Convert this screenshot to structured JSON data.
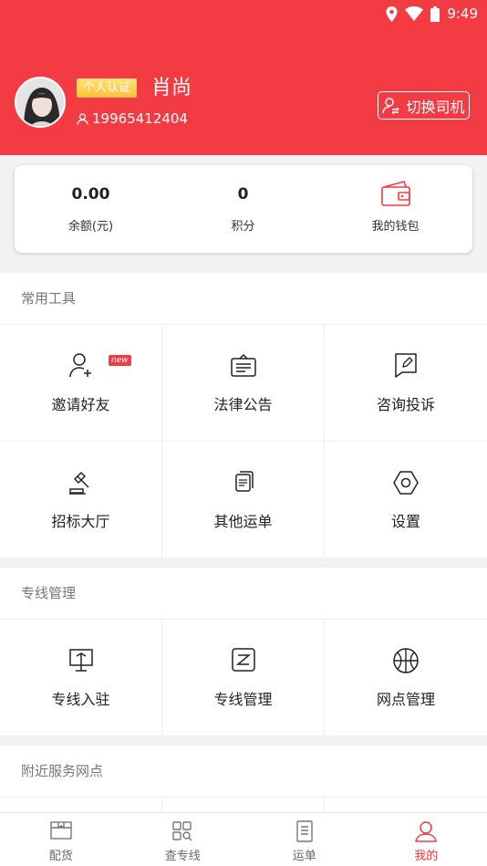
{
  "status_bar": {
    "time": "9:49",
    "icons": [
      "location-icon",
      "wifi-icon",
      "battery-icon"
    ]
  },
  "profile": {
    "badge": "个人认证",
    "name": "肖尚",
    "phone": "19965412404",
    "switch_label": "切换司机"
  },
  "wallet": {
    "balance_value": "0.00",
    "balance_label": "余额(元)",
    "points_value": "0",
    "points_label": "积分",
    "wallet_label": "我的钱包"
  },
  "tools": {
    "title": "常用工具",
    "new_tag": "new",
    "items": [
      {
        "label": "邀请好友",
        "icon": "add-user-icon"
      },
      {
        "label": "法律公告",
        "icon": "notice-icon"
      },
      {
        "label": "咨询投诉",
        "icon": "complaint-icon"
      },
      {
        "label": "招标大厅",
        "icon": "gavel-icon"
      },
      {
        "label": "其他运单",
        "icon": "documents-icon"
      },
      {
        "label": "设置",
        "icon": "settings-icon"
      }
    ]
  },
  "line_mgmt": {
    "title": "专线管理",
    "items": [
      {
        "label": "专线入驻",
        "icon": "board-icon"
      },
      {
        "label": "专线管理",
        "icon": "line-manage-icon"
      },
      {
        "label": "网点管理",
        "icon": "network-icon"
      }
    ]
  },
  "nearby": {
    "title": "附近服务网点"
  },
  "tabbar": {
    "tabs": [
      {
        "label": "配货",
        "icon": "cargo-icon"
      },
      {
        "label": "查专线",
        "icon": "search-line-icon"
      },
      {
        "label": "运单",
        "icon": "waybill-icon"
      },
      {
        "label": "我的",
        "icon": "profile-icon"
      }
    ],
    "active_index": 3
  },
  "colors": {
    "brand": "#f33b43",
    "badge": "#ffbf3a",
    "background": "#f2f2f2"
  }
}
